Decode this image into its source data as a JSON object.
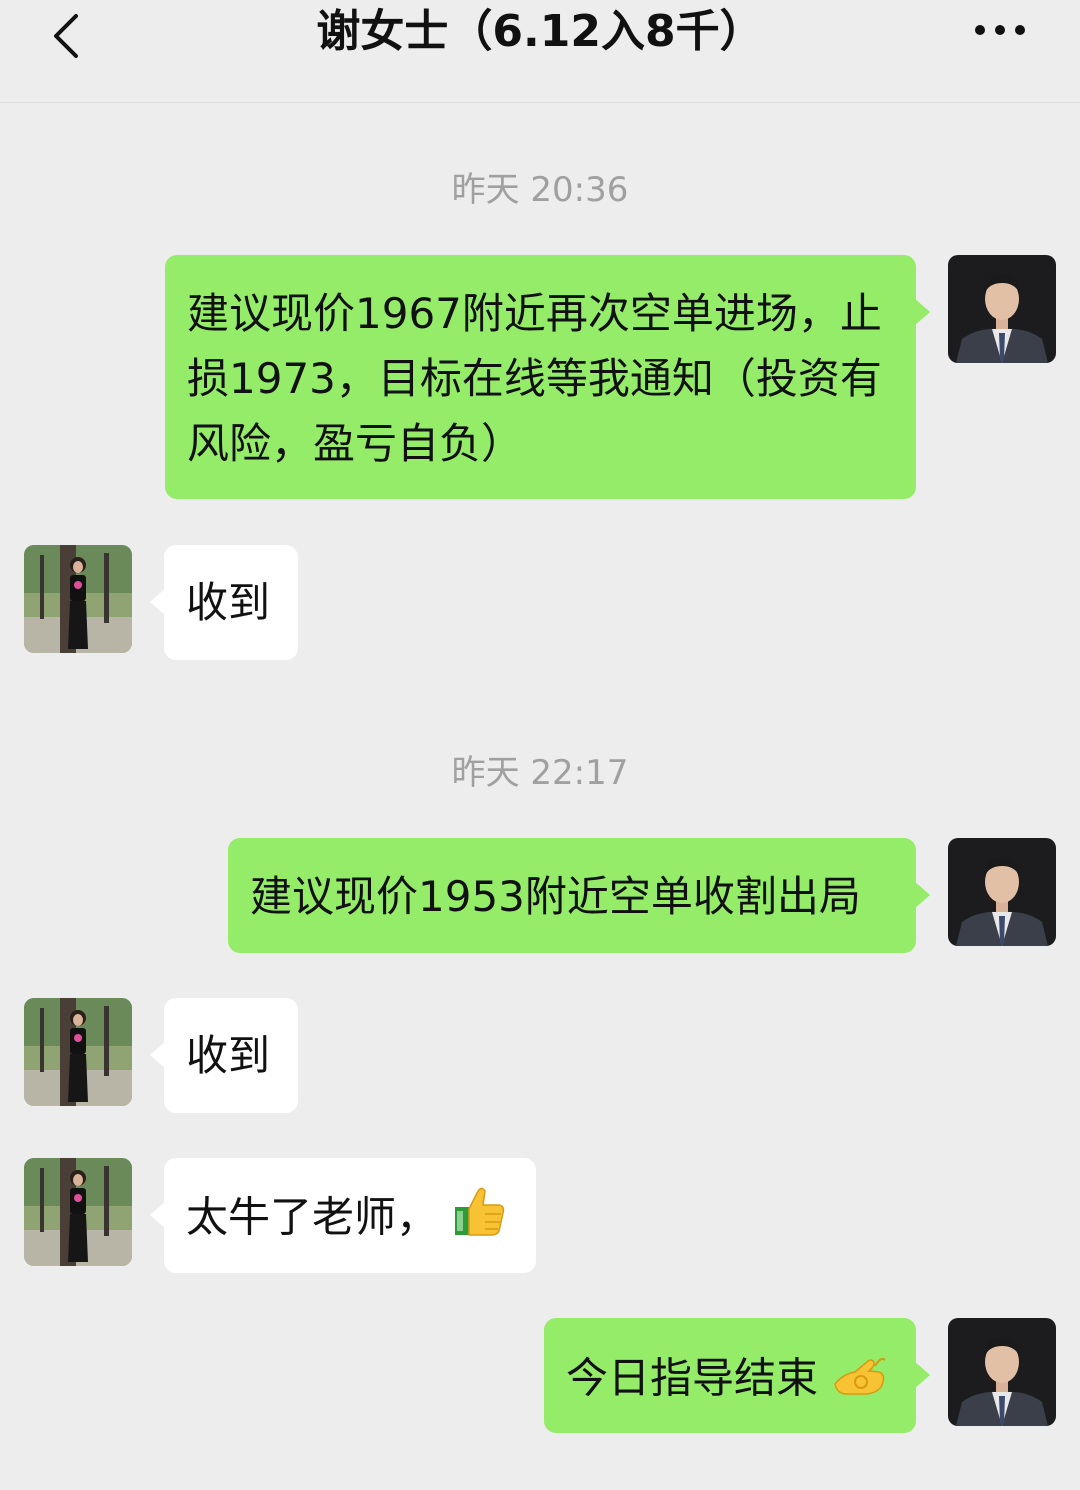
{
  "header": {
    "title": "谢女士（6.12入8千）",
    "back_icon": "chevron-left-icon",
    "more_icon": "more-dots-icon"
  },
  "timestamps": [
    "昨天 20:36",
    "昨天 22:17"
  ],
  "messages": [
    {
      "sender": "me",
      "text": "建议现价1967附近再次空单进场，止损1973，目标在线等我通知（投资有风险，盈亏自负）"
    },
    {
      "sender": "her",
      "text": "收到"
    },
    {
      "sender": "me",
      "text": "建议现价1953附近空单收割出局"
    },
    {
      "sender": "her",
      "text": "收到"
    },
    {
      "sender": "her",
      "text": "太牛了老师，",
      "emoji": "thumbs-up-icon"
    },
    {
      "sender": "me",
      "text": "今日指导结束",
      "emoji": "ok-hand-icon"
    }
  ],
  "colors": {
    "background": "#ededed",
    "outgoing_bubble": "#95ec69",
    "incoming_bubble": "#ffffff",
    "timestamp_text": "#a0a0a0"
  }
}
